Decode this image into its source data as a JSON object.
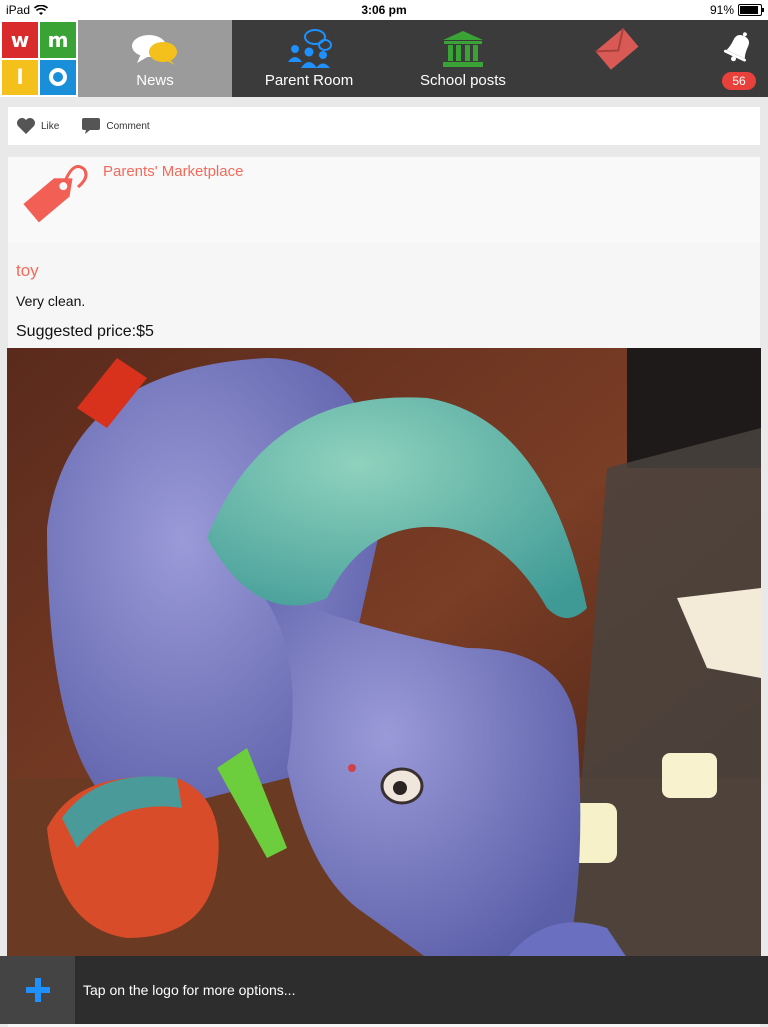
{
  "status": {
    "device": "iPad",
    "time": "3:06 pm",
    "battery": "91%"
  },
  "nav": {
    "logo_letters": [
      "w",
      "m",
      "l",
      "o"
    ],
    "tabs": [
      {
        "label": "News",
        "icon": "chat-bubbles-icon",
        "active": true
      },
      {
        "label": "Parent Room",
        "icon": "parents-group-icon",
        "active": false
      },
      {
        "label": "School posts",
        "icon": "school-building-icon",
        "active": false
      }
    ],
    "mail_icon": "envelope-icon",
    "notifications": {
      "icon": "bell-icon",
      "count": "56"
    }
  },
  "actions": {
    "like": "Like",
    "comment": "Comment"
  },
  "post": {
    "category": "Parents' Marketplace",
    "category_icon": "price-tag-icon",
    "title": "toy",
    "description": "Very clean.",
    "price": "Suggested price:$5"
  },
  "bottom": {
    "add_icon": "plus-icon",
    "hint": "Tap on the logo for more options..."
  },
  "colors": {
    "accent": "#f26b5b",
    "nav_bg": "#3b3b3b",
    "active_tab": "#9b9b9b",
    "badge": "#e8413b"
  }
}
